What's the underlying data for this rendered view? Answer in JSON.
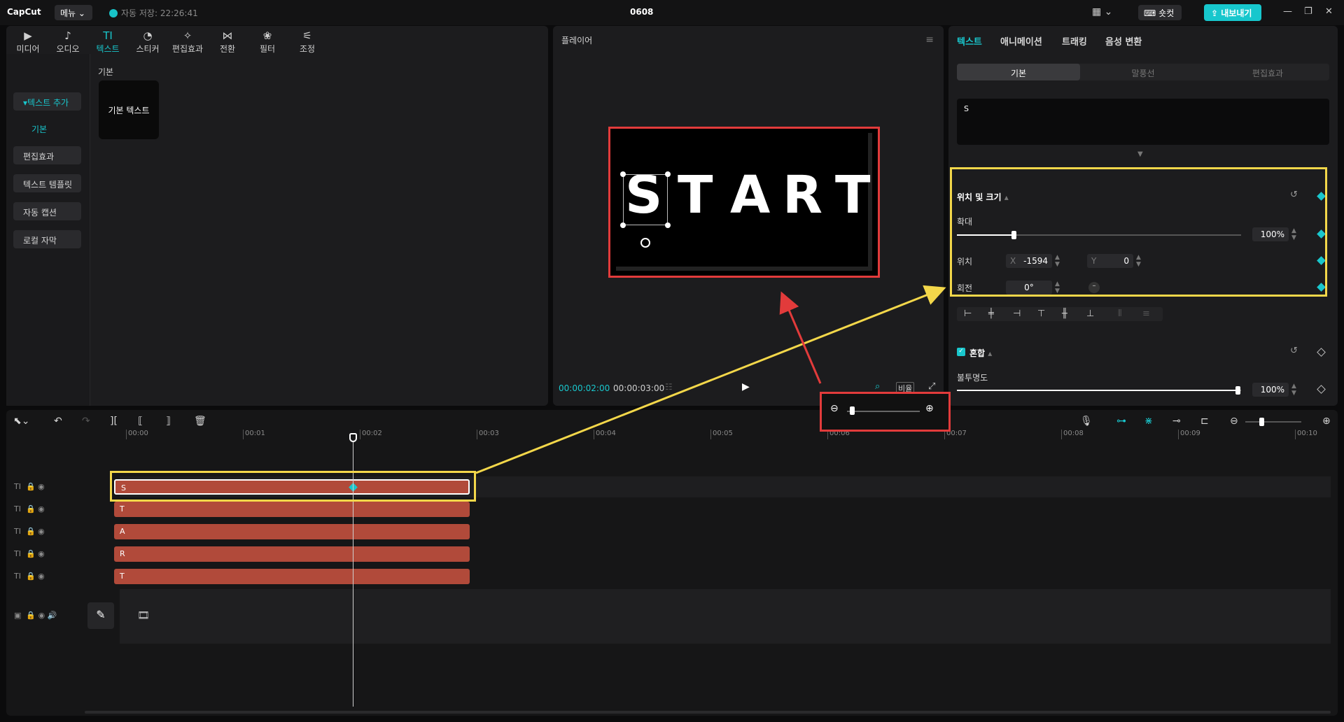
{
  "app": {
    "logo": "CapCut",
    "menu_label": "메뉴",
    "autosave": "자동 저장: 22:26:41",
    "project_title": "0608",
    "shortcut_label": "숏컷",
    "export_label": "내보내기"
  },
  "toolbar": {
    "items": [
      {
        "label": "미디어",
        "icon": "media-icon"
      },
      {
        "label": "오디오",
        "icon": "audio-icon"
      },
      {
        "label": "텍스트",
        "icon": "text-icon"
      },
      {
        "label": "스티커",
        "icon": "sticker-icon"
      },
      {
        "label": "편집효과",
        "icon": "effects-icon"
      },
      {
        "label": "전환",
        "icon": "transition-icon"
      },
      {
        "label": "필터",
        "icon": "filter-icon"
      },
      {
        "label": "조정",
        "icon": "adjust-icon"
      }
    ]
  },
  "sidebar": {
    "items": [
      "텍스트 추가",
      "기본",
      "편집효과",
      "텍스트 템플릿",
      "자동 캡션",
      "로컬 자막"
    ]
  },
  "library": {
    "section_label": "기본",
    "card_label": "기본 텍스트"
  },
  "player": {
    "title": "플레이어",
    "preview_letters": [
      "S",
      "T",
      "A",
      "R",
      "T"
    ],
    "current_time": "00:00:02:00",
    "total_time": "00:00:03:00",
    "ratio_label": "비율"
  },
  "inspector": {
    "tabs": [
      "텍스트",
      "애니메이션",
      "트래킹",
      "음성 변환"
    ],
    "subtabs": [
      "기본",
      "말풍선",
      "편집효과"
    ],
    "text_value": "S",
    "transform_title": "위치 및 크기",
    "scale_label": "확대",
    "scale_value": "100%",
    "scale_fraction": 0.2,
    "position_label": "위치",
    "x_prefix": "X",
    "x_value": "-1594",
    "y_prefix": "Y",
    "y_value": "0",
    "rotation_label": "회전",
    "rotation_value": "0°",
    "blend_title": "혼합",
    "opacity_label": "불투명도",
    "opacity_value": "100%"
  },
  "timeline": {
    "ruler_ticks": [
      "00:00",
      "00:01",
      "00:02",
      "00:03",
      "00:04",
      "00:05",
      "00:06",
      "00:07",
      "00:08",
      "00:09",
      "00:10"
    ],
    "tracks": [
      "S",
      "T",
      "A",
      "R",
      "T"
    ],
    "track_icon": "TI"
  },
  "colors": {
    "accent": "#19c7cd",
    "clip": "#b14a3a",
    "annotation_red": "#e23b3b",
    "annotation_yellow": "#f3d74a"
  }
}
